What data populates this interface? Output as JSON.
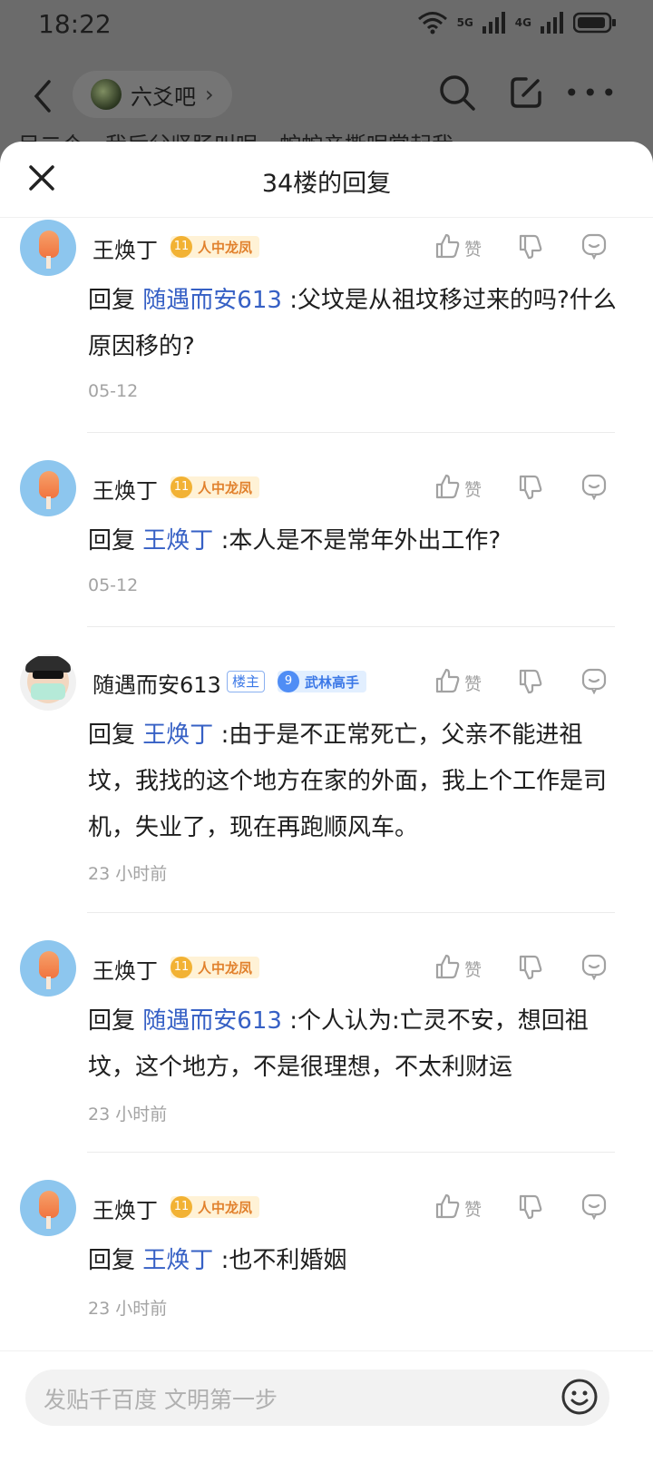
{
  "status": {
    "time": "18:22",
    "net1": "5G",
    "net2": "4G"
  },
  "nav": {
    "forum_name": "六爻吧",
    "chevron": "›"
  },
  "background_peek": "目二个，我后父竖肠叫呢，蛇蛇亲撕呢赏起我~",
  "sheet": {
    "title": "34楼的回复"
  },
  "comments": [
    {
      "name": "王焕丁",
      "level": "11",
      "level_title": "人中龙凤",
      "like": "赞",
      "reply_word": "回复",
      "mention": "随遇而安613",
      "text": ":父坟是从祖坟移过来的吗?什么原因移的?",
      "time": "05-12"
    },
    {
      "name": "王焕丁",
      "level": "11",
      "level_title": "人中龙凤",
      "like": "赞",
      "reply_word": "回复",
      "mention": "王焕丁",
      "text": ":本人是不是常年外出工作?",
      "time": "05-12"
    },
    {
      "name": "随遇而安613",
      "owner_tag": "楼主",
      "level": "9",
      "level_title": "武林高手",
      "like": "赞",
      "reply_word": "回复",
      "mention": "王焕丁",
      "text": ":由于是不正常死亡，父亲不能进祖坟，我找的这个地方在家的外面，我上个工作是司机，失业了，现在再跑顺风车。",
      "time": "23 小时前"
    },
    {
      "name": "王焕丁",
      "level": "11",
      "level_title": "人中龙凤",
      "like": "赞",
      "reply_word": "回复",
      "mention": "随遇而安613",
      "text": ":个人认为:亡灵不安，想回祖坟，这个地方，不是很理想，不太利财运",
      "time": "23 小时前"
    },
    {
      "name": "王焕丁",
      "level": "11",
      "level_title": "人中龙凤",
      "like": "赞",
      "reply_word": "回复",
      "mention": "王焕丁",
      "text": ":也不利婚姻",
      "time": "23 小时前"
    }
  ],
  "input": {
    "placeholder": "发贴千百度 文明第一步"
  },
  "icons": [
    "back-icon",
    "search-icon",
    "edit-icon",
    "more-icon",
    "close-icon",
    "thumb-up-icon",
    "thumb-down-icon",
    "comment-icon",
    "emoji-icon",
    "wifi-icon",
    "signal-icon",
    "battery-icon"
  ],
  "colors": {
    "mention": "#3660c5",
    "level_gold": "#f2b234",
    "level_blue": "#4f8df5",
    "muted": "#a3a3a3"
  }
}
